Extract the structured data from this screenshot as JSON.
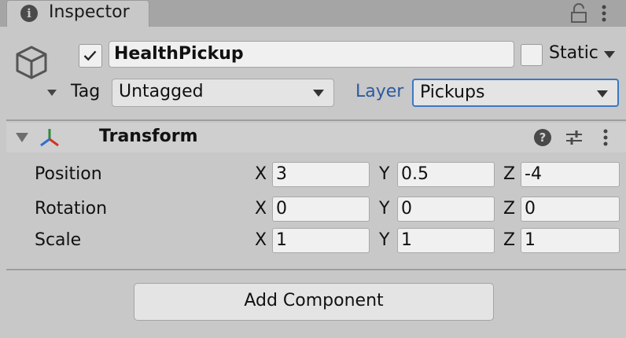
{
  "tab": {
    "title": "Inspector",
    "icon": "info-icon"
  },
  "header": {
    "active": true,
    "name": "HealthPickup",
    "static_label": "Static",
    "static_checked": false,
    "tag_label": "Tag",
    "tag_value": "Untagged",
    "layer_label": "Layer",
    "layer_value": "Pickups"
  },
  "transform": {
    "title": "Transform",
    "rows": [
      {
        "label": "Position",
        "x": "3",
        "y": "0.5",
        "z": "-4"
      },
      {
        "label": "Rotation",
        "x": "0",
        "y": "0",
        "z": "0"
      },
      {
        "label": "Scale",
        "x": "1",
        "y": "1",
        "z": "1"
      }
    ],
    "axis_x": "X",
    "axis_y": "Y",
    "axis_z": "Z"
  },
  "add_component_label": "Add Component",
  "colors": {
    "accent": "#3a78c4",
    "layer_label": "#2c5aa0",
    "background": "#c8c8c8"
  }
}
